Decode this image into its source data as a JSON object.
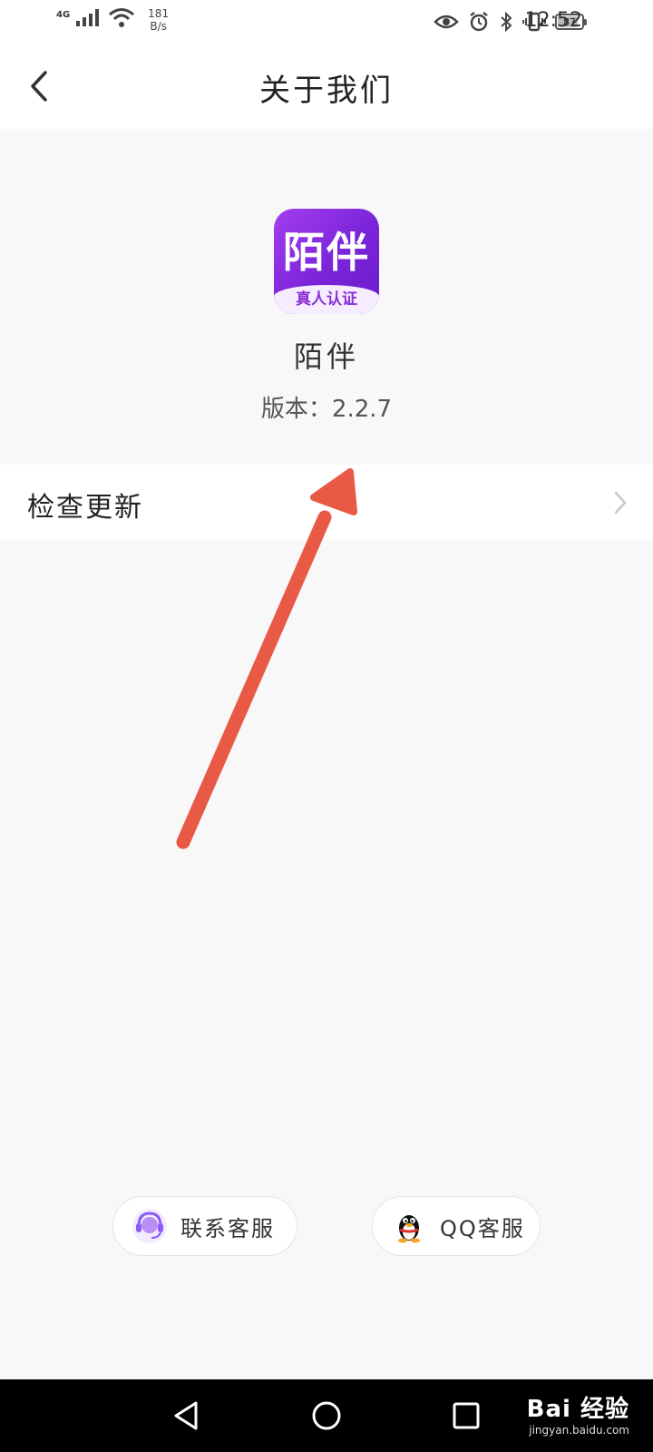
{
  "status_bar": {
    "network_type": "4G",
    "speed_value": "181",
    "speed_unit": "B/s",
    "battery_level": "87",
    "time": "12:52"
  },
  "header": {
    "title": "关于我们"
  },
  "app": {
    "icon_text": "陌伴",
    "icon_badge": "真人认证",
    "name": "陌伴",
    "version": "版本：2.2.7"
  },
  "menu": {
    "check_update_label": "检查更新"
  },
  "footer": {
    "customer_service_label": "联系客服",
    "qq_service_label": "QQ客服"
  },
  "watermark": {
    "brand": "Bai 经验",
    "url": "jingyan.baidu.com"
  },
  "colors": {
    "annotation_arrow": "#e85a45",
    "app_icon_purple": "#8a2fd6",
    "page_background": "#f8f8f8"
  }
}
